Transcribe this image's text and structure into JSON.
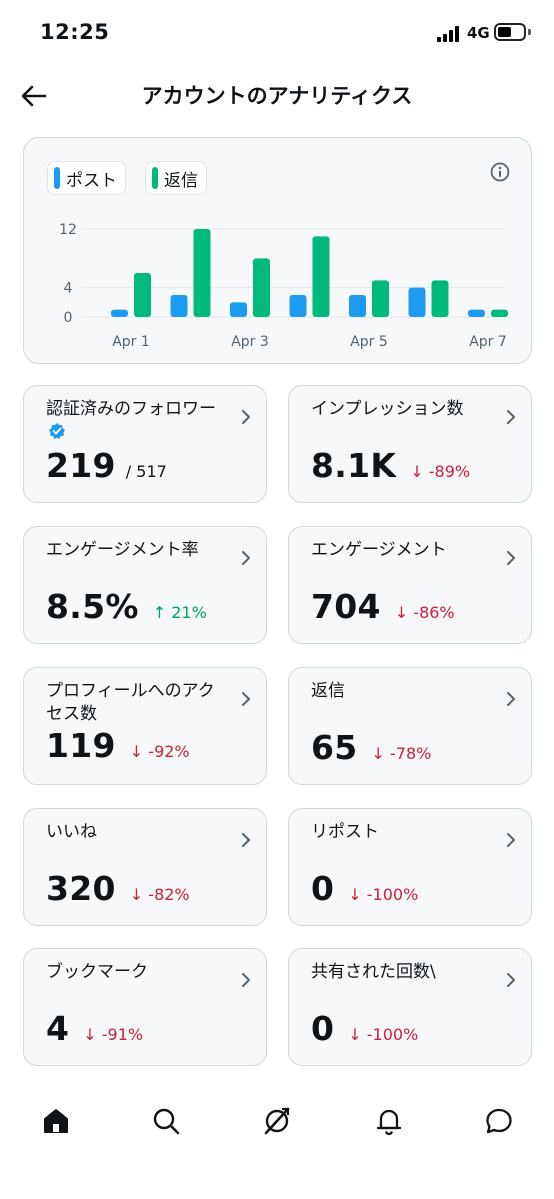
{
  "status_bar": {
    "time": "12:25",
    "network": "4G"
  },
  "header": {
    "title": "アカウントのアナリティクス"
  },
  "legend": {
    "posts_label": "ポスト",
    "replies_label": "返信"
  },
  "colors": {
    "posts": "#1d9bf0",
    "replies": "#00ba7c",
    "down": "#cc1f3a",
    "up": "#00a266"
  },
  "chart_data": {
    "type": "bar",
    "categories": [
      "Apr 1",
      "Apr 2",
      "Apr 3",
      "Apr 4",
      "Apr 5",
      "Apr 6",
      "Apr 7"
    ],
    "tick_labels": [
      "Apr 1",
      "Apr 3",
      "Apr 5",
      "Apr 7"
    ],
    "y_ticks": [
      "12",
      "4",
      "0"
    ],
    "ylim": [
      0,
      13
    ],
    "series": [
      {
        "name": "ポスト",
        "values": [
          1,
          3,
          2,
          3,
          3,
          4,
          1
        ]
      },
      {
        "name": "返信",
        "values": [
          6,
          12,
          8,
          11,
          5,
          5,
          1
        ]
      }
    ],
    "grid": true
  },
  "metrics": [
    {
      "label": "認証済みのフォロワー",
      "value": "219",
      "total": "/ 517",
      "change": ""
    },
    {
      "label": "インプレッション数",
      "value": "8.1K",
      "change": "-89%"
    },
    {
      "label": "エンゲージメント率",
      "value": "8.5%",
      "change": "21%"
    },
    {
      "label": "エンゲージメント",
      "value": "704",
      "change": "-86%"
    },
    {
      "label": "プロフィールへのアクセス数",
      "value": "119",
      "change": "-92%"
    },
    {
      "label": "返信",
      "value": "65",
      "change": "-78%"
    },
    {
      "label": "いいね",
      "value": "320",
      "change": "-82%"
    },
    {
      "label": "リポスト",
      "value": "0",
      "change": "-100%"
    },
    {
      "label": "ブックマーク",
      "value": "4",
      "change": "-91%"
    },
    {
      "label": "共有された回数\\",
      "value": "0",
      "change": "-100%"
    }
  ],
  "nav": [
    "home-icon",
    "search-icon",
    "grok-icon",
    "notifications-icon",
    "messages-icon"
  ]
}
